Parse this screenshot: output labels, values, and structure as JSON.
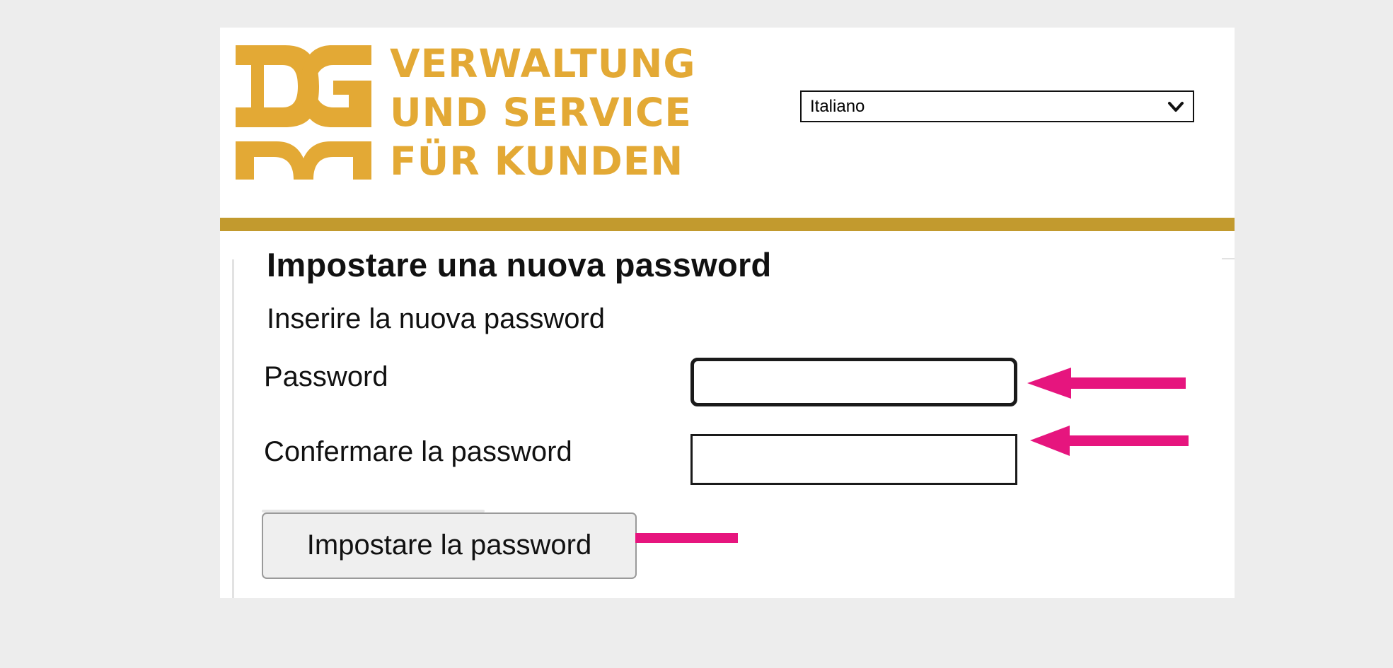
{
  "colors": {
    "background": "#ededed",
    "panel": "#ffffff",
    "brand_gold": "#e3a935",
    "divider_gold": "#c29a2e",
    "annotation_arrow": "#e6157e"
  },
  "header": {
    "logo": {
      "icon": "dg-monogram-logo",
      "lines": [
        "VERWALTUNG",
        "UND SERVICE",
        "FÜR KUNDEN"
      ]
    },
    "language_select": {
      "value": "Italiano",
      "icon": "chevron-down-icon"
    }
  },
  "form": {
    "title": "Impostare una nuova password",
    "subtitle": "Inserire la nuova password",
    "password_label": "Password",
    "password_value": "",
    "confirm_label": "Confermare la password",
    "confirm_value": "",
    "submit_label": "Impostare la password"
  },
  "annotations": {
    "icon": "arrow-left-icon",
    "count": 3
  }
}
